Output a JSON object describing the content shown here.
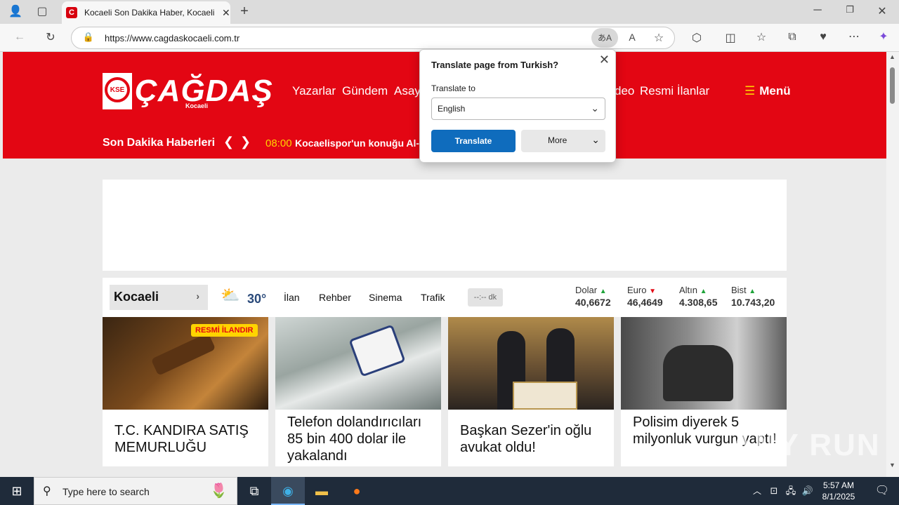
{
  "browser": {
    "tab_title": "Kocaeli Son Dakika Haber, Kocaeli",
    "tab_favicon": "C",
    "url": "https://www.cagdaskocaeli.com.tr"
  },
  "translate_popup": {
    "title": "Translate page from Turkish?",
    "label": "Translate to",
    "language": "English",
    "translate_button": "Translate",
    "more_button": "More"
  },
  "site": {
    "logo_text": "ÇAĞDAŞ",
    "logo_sub": "Kocaeli",
    "logo_emblem": "KSE",
    "nav": [
      "Yazarlar",
      "Gündem",
      "Asay",
      "deo",
      "Resmi İlanlar"
    ],
    "menu_label": "Menü",
    "breaking_label": "Son Dakika Haberleri",
    "breaking_time": "08:00",
    "breaking_text": "Kocaelispor'un konuğu Al-W"
  },
  "infobar": {
    "city": "Kocaeli",
    "temperature": "30°",
    "links": [
      "İlan",
      "Rehber",
      "Sinema",
      "Trafik"
    ],
    "countdown": "--:-- dk",
    "rates": [
      {
        "name": "Dolar",
        "value": "40,6672",
        "trend": "up"
      },
      {
        "name": "Euro",
        "value": "46,4649",
        "trend": "down"
      },
      {
        "name": "Altın",
        "value": "4.308,65",
        "trend": "up"
      },
      {
        "name": "Bist",
        "value": "10.743,20",
        "trend": "up"
      }
    ]
  },
  "cards": [
    {
      "title": "T.C. KANDIRA SATIŞ MEMURLUĞU",
      "badge": "RESMİ İLANDIR"
    },
    {
      "title": "Telefon dolandırıcıları 85 bin 400 dolar ile yakalandı"
    },
    {
      "title": "Başkan Sezer'in oğlu avukat oldu!"
    },
    {
      "title": "Polisim diyerek 5 milyonluk vurgun yaptı!"
    }
  ],
  "taskbar": {
    "search_placeholder": "Type here to search",
    "time": "5:57 AM",
    "date": "8/1/2025"
  },
  "watermark": "ANY RUN",
  "colors": {
    "brand_red": "#e30613",
    "accent_yellow": "#ffd400",
    "edge_blue": "#0f6cbd"
  }
}
